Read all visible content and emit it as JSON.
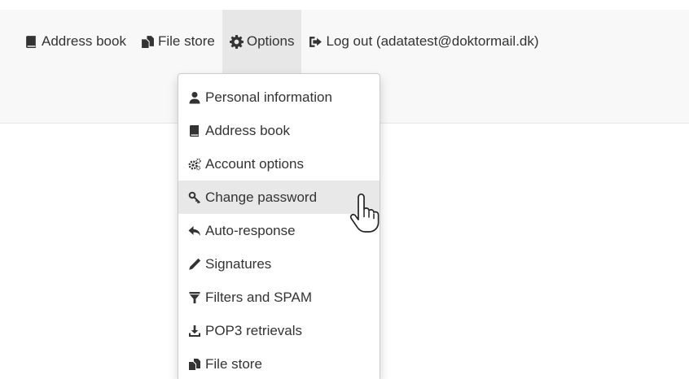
{
  "nav": {
    "items": [
      {
        "label": "Address book",
        "icon": "book-icon"
      },
      {
        "label": "File store",
        "icon": "files-icon"
      },
      {
        "label": "Options",
        "icon": "cog-icon",
        "active": true
      },
      {
        "label": "Log out (adatatest@doktormail.dk)",
        "icon": "log-out-icon"
      }
    ]
  },
  "options_menu": {
    "items": [
      {
        "label": "Personal information",
        "icon": "user-icon"
      },
      {
        "label": "Address book",
        "icon": "book-icon"
      },
      {
        "label": "Account options",
        "icon": "cogs-icon"
      },
      {
        "label": "Change password",
        "icon": "key-icon",
        "hovered": true
      },
      {
        "label": "Auto-response",
        "icon": "reply-icon"
      },
      {
        "label": "Signatures",
        "icon": "pen-icon"
      },
      {
        "label": "Filters and SPAM",
        "icon": "filter-icon"
      },
      {
        "label": "POP3 retrievals",
        "icon": "download-icon"
      },
      {
        "label": "File store",
        "icon": "files-icon"
      }
    ]
  },
  "colors": {
    "navbar_bg": "#f8f8f8",
    "active_bg": "#e7e7e7",
    "hover_bg": "#e8e8e8",
    "text": "#333333"
  }
}
